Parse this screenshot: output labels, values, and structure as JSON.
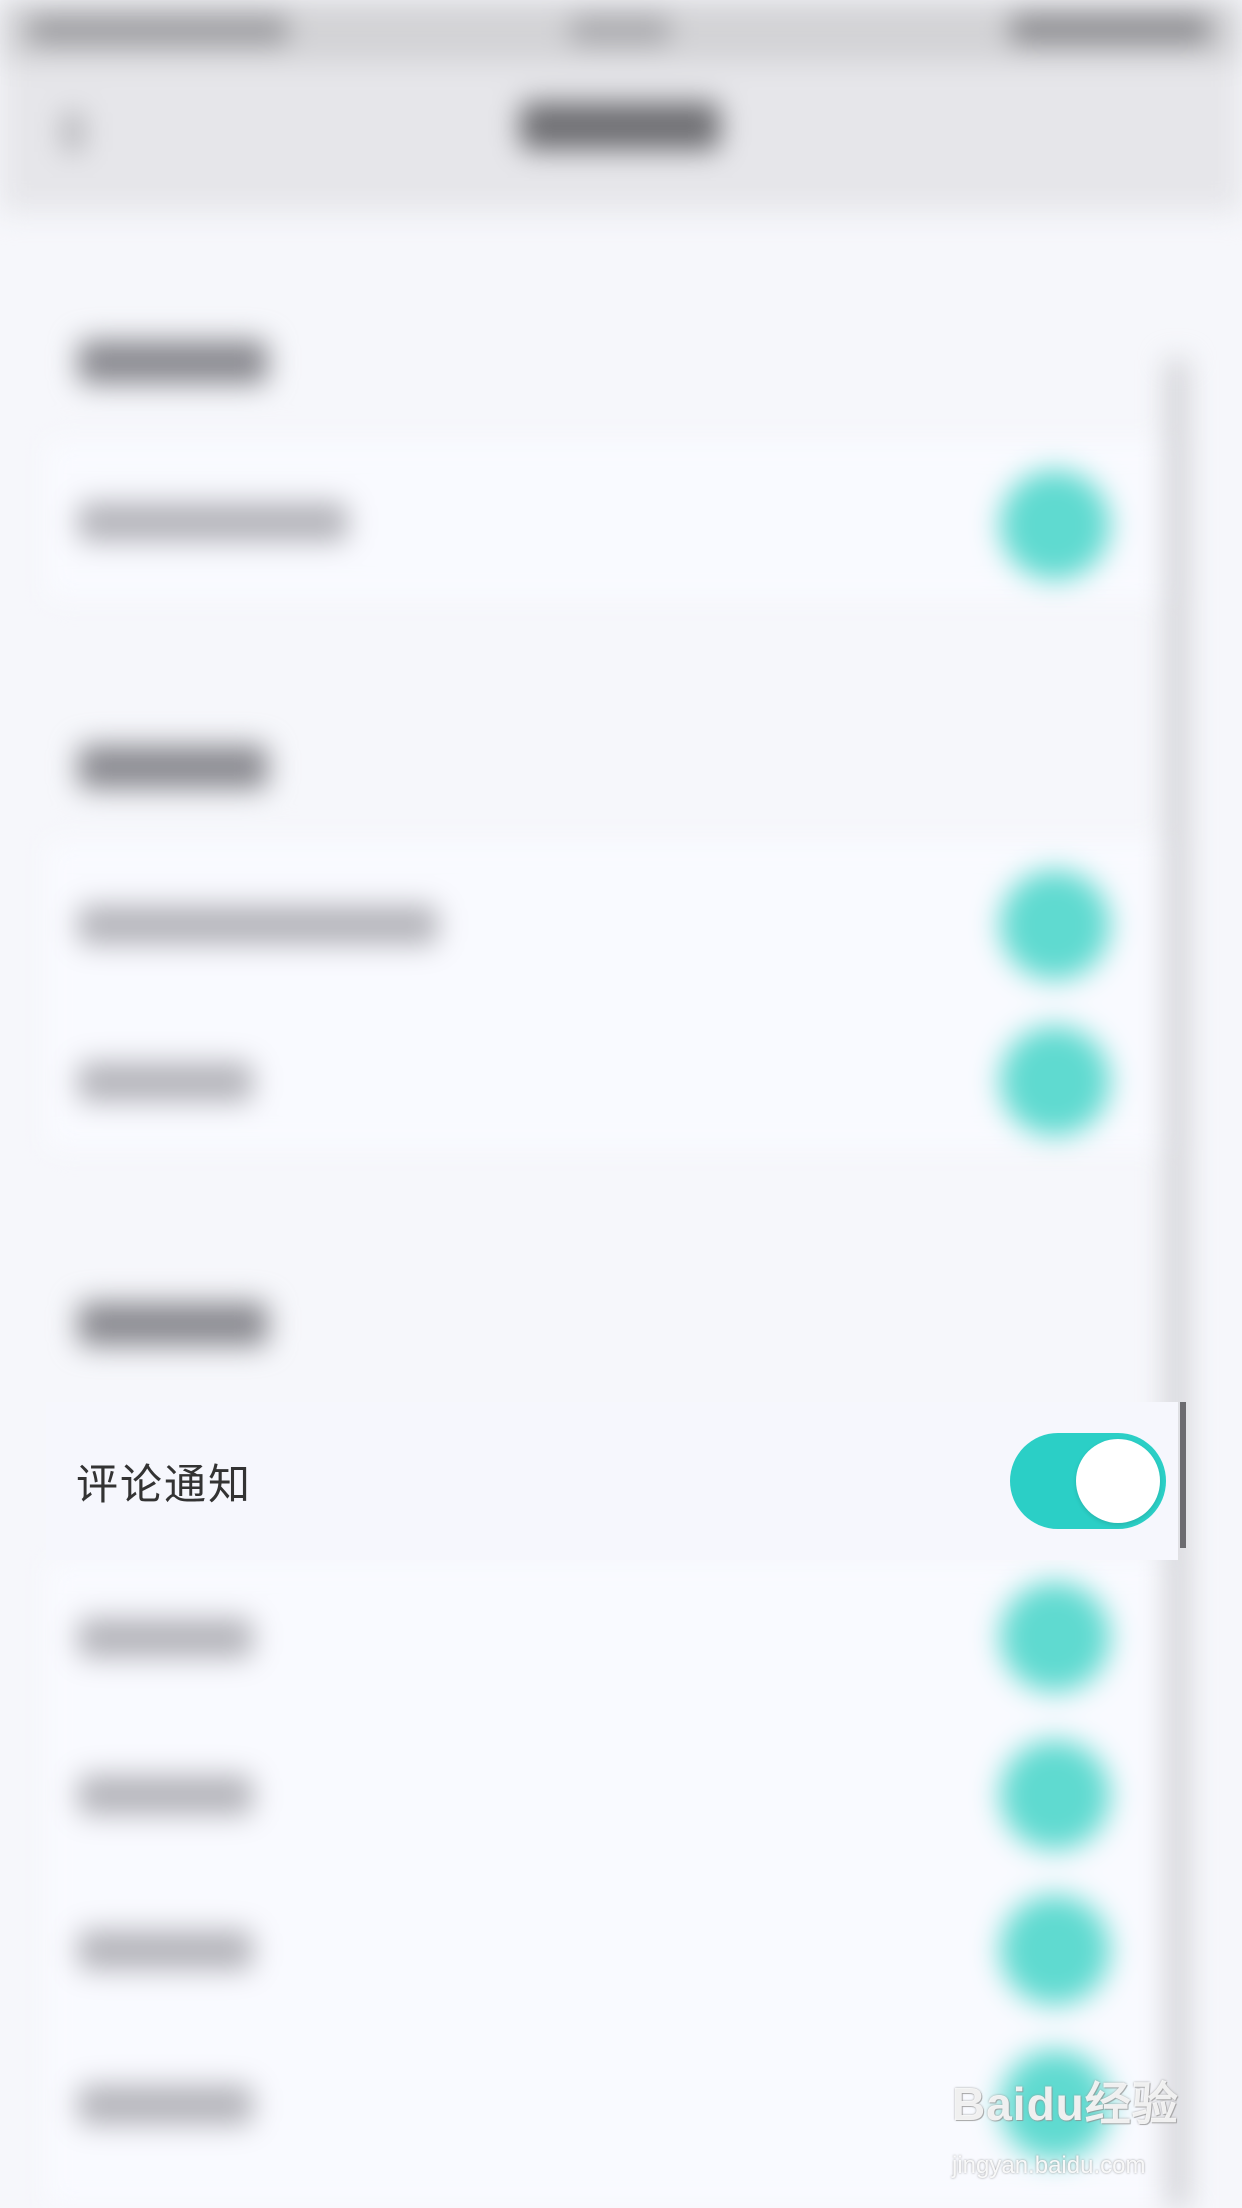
{
  "settings": {
    "focused_row": {
      "label": "评论通知",
      "toggle_on": true
    }
  },
  "colors": {
    "accent": "#2bcfc6",
    "background": "#f6f7fb",
    "label_text": "#333333"
  },
  "icons": {
    "toggle": "toggle-switch-icon"
  },
  "watermark": {
    "main": "Baidu经验",
    "sub": "jingyan.baidu.com"
  }
}
